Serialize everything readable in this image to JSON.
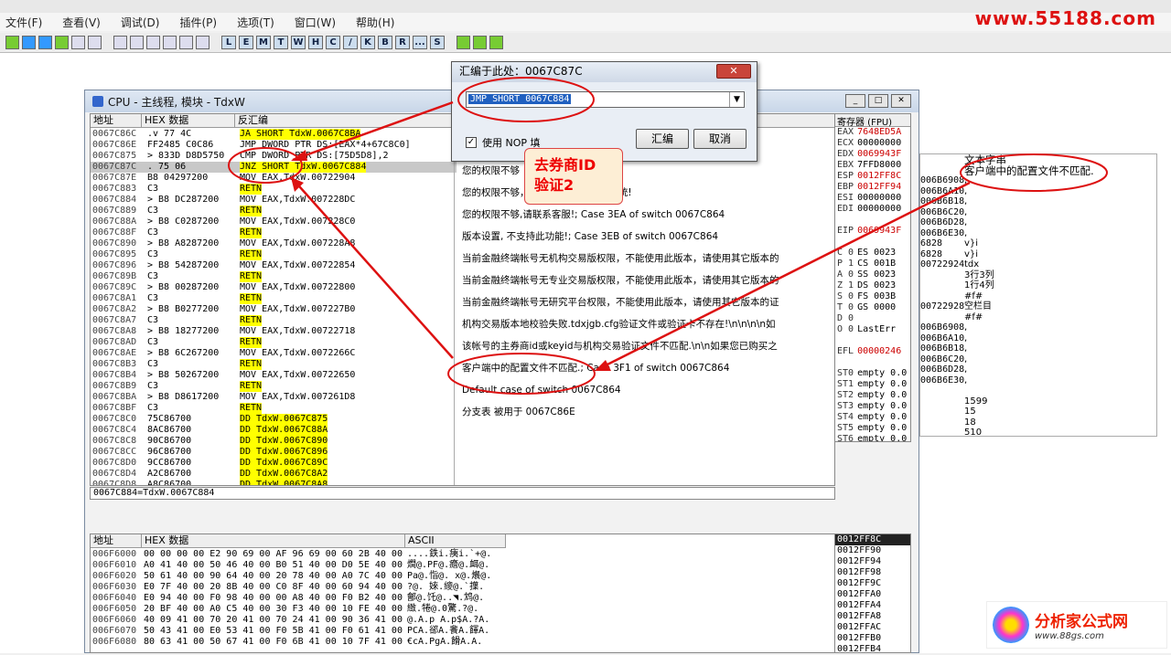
{
  "menu": [
    "文件(F)",
    "查看(V)",
    "调试(D)",
    "插件(P)",
    "选项(T)",
    "窗口(W)",
    "帮助(H)"
  ],
  "toolbar_letters": [
    "L",
    "E",
    "M",
    "T",
    "W",
    "H",
    "C",
    "/",
    "K",
    "B",
    "R",
    "...",
    "S"
  ],
  "brand_top": "www.55188.com",
  "cpu_title": "CPU - 主线程, 模块 - TdxW",
  "headers": {
    "addr": "地址",
    "hex": "HEX 数据",
    "dis": "反汇编",
    "regs": "寄存器 (FPU)",
    "dump_addr": "地址",
    "dump_hex": "HEX 数据",
    "dump_ascii": "ASCII",
    "text_str": "文本字串"
  },
  "disasm": [
    {
      "a": "0067C86C",
      "h": ".v 77 4C",
      "d": "JA SHORT TdxW.0067C8BA",
      "hl": true
    },
    {
      "a": "0067C86E",
      "h": "  FF2485 C0C86",
      "d": "JMP DWORD PTR DS:[EAX*4+67C8C0]",
      "hl": false
    },
    {
      "a": "0067C875",
      "h": ">  833D D8D5750",
      "d": "CMP DWORD PTR DS:[75D5D8],2",
      "hl": false
    },
    {
      "a": "0067C87C",
      "h": ". 75 06",
      "d": "JNZ SHORT TdxW.0067C884",
      "hl": true
    },
    {
      "a": "0067C87E",
      "h": "  B8 04297200",
      "d": "MOV EAX,TdxW.00722904",
      "hl": false
    },
    {
      "a": "0067C883",
      "h": "  C3",
      "d": "RETN",
      "hl": false
    },
    {
      "a": "0067C884",
      "h": ">  B8 DC287200",
      "d": "MOV EAX,TdxW.007228DC",
      "hl": false
    },
    {
      "a": "0067C889",
      "h": "  C3",
      "d": "RETN",
      "hl": false
    },
    {
      "a": "0067C88A",
      "h": ">  B8 C0287200",
      "d": "MOV EAX,TdxW.007228C0",
      "hl": false
    },
    {
      "a": "0067C88F",
      "h": "  C3",
      "d": "RETN",
      "hl": false
    },
    {
      "a": "0067C890",
      "h": ">  B8 A8287200",
      "d": "MOV EAX,TdxW.007228A8",
      "hl": false
    },
    {
      "a": "0067C895",
      "h": "  C3",
      "d": "RETN",
      "hl": false
    },
    {
      "a": "0067C896",
      "h": ">  B8 54287200",
      "d": "MOV EAX,TdxW.00722854",
      "hl": false
    },
    {
      "a": "0067C89B",
      "h": "  C3",
      "d": "RETN",
      "hl": false
    },
    {
      "a": "0067C89C",
      "h": ">  B8 00287200",
      "d": "MOV EAX,TdxW.00722800",
      "hl": false
    },
    {
      "a": "0067C8A1",
      "h": "  C3",
      "d": "RETN",
      "hl": false
    },
    {
      "a": "0067C8A2",
      "h": ">  B8 B0277200",
      "d": "MOV EAX,TdxW.007227B0",
      "hl": false
    },
    {
      "a": "0067C8A7",
      "h": "  C3",
      "d": "RETN",
      "hl": false
    },
    {
      "a": "0067C8A8",
      "h": ">  B8 18277200",
      "d": "MOV EAX,TdxW.00722718",
      "hl": false
    },
    {
      "a": "0067C8AD",
      "h": "  C3",
      "d": "RETN",
      "hl": false
    },
    {
      "a": "0067C8AE",
      "h": ">  B8 6C267200",
      "d": "MOV EAX,TdxW.0072266C",
      "hl": false
    },
    {
      "a": "0067C8B3",
      "h": "  C3",
      "d": "RETN",
      "hl": false
    },
    {
      "a": "0067C8B4",
      "h": ">  B8 50267200",
      "d": "MOV EAX,TdxW.00722650",
      "hl": false
    },
    {
      "a": "0067C8B9",
      "h": "  C3",
      "d": "RETN",
      "hl": false
    },
    {
      "a": "0067C8BA",
      "h": ">  B8 D8617200",
      "d": "MOV EAX,TdxW.007261D8",
      "hl": false
    },
    {
      "a": "0067C8BF",
      "h": "  C3",
      "d": "RETN",
      "hl": false
    },
    {
      "a": "0067C8C0",
      "h": "  75C86700",
      "d": "DD TdxW.0067C875",
      "hl": false
    },
    {
      "a": "0067C8C4",
      "h": "  8AC86700",
      "d": "DD TdxW.0067C88A",
      "hl": false
    },
    {
      "a": "0067C8C8",
      "h": "  90C86700",
      "d": "DD TdxW.0067C890",
      "hl": false
    },
    {
      "a": "0067C8CC",
      "h": "  96C86700",
      "d": "DD TdxW.0067C896",
      "hl": false
    },
    {
      "a": "0067C8D0",
      "h": "  9CC86700",
      "d": "DD TdxW.0067C89C",
      "hl": false
    },
    {
      "a": "0067C8D4",
      "h": "  A2C86700",
      "d": "DD TdxW.0067C8A2",
      "hl": false
    },
    {
      "a": "0067C8D8",
      "h": "  A8C86700",
      "d": "DD TdxW.0067C8A8",
      "hl": false
    }
  ],
  "comments": [
    "您的权限不够",
    "您的权限不够，请联系客服... 交易系统!",
    "您的权限不够,请联系客服!; Case 3EA of switch 0067C864",
    "版本设置, 不支持此功能!; Case 3EB of switch 0067C864",
    "当前金融终端帐号无机构交易版权限，不能使用此版本，请使用其它版本的",
    "当前金融终端帐号无专业交易版权限，不能使用此版本，请使用其它版本的",
    "当前金融终端帐号无研究平台权限，不能使用此版本，请使用其它版本的证",
    "机构交易版本地校验失败.tdxjgb.cfg验证文件或验证卡不存在!\\n\\n\\n\\n如",
    "该帐号的主券商id或keyid与机构交易验证文件不匹配.\\n\\n如果您已购买之",
    "客户端中的配置文件不匹配.; Case 3F1 of switch 0067C864",
    "Default case of switch 0067C864",
    "分支表 被用于 0067C86E"
  ],
  "regs": [
    {
      "n": "EAX",
      "v": "7648ED5A",
      "red": true
    },
    {
      "n": "ECX",
      "v": "00000000",
      "red": false
    },
    {
      "n": "EDX",
      "v": "0069943F",
      "red": true
    },
    {
      "n": "EBX",
      "v": "7FFD8000",
      "red": false
    },
    {
      "n": "ESP",
      "v": "0012FF8C",
      "red": true
    },
    {
      "n": "EBP",
      "v": "0012FF94",
      "red": true
    },
    {
      "n": "ESI",
      "v": "00000000",
      "red": false
    },
    {
      "n": "EDI",
      "v": "00000000",
      "red": false
    },
    {
      "n": "",
      "v": "",
      "red": false
    },
    {
      "n": "EIP",
      "v": "0069943F",
      "red": true
    },
    {
      "n": "",
      "v": "",
      "red": false
    },
    {
      "n": "C 0",
      "v": "ES 0023",
      "red": false
    },
    {
      "n": "P 1",
      "v": "CS 001B",
      "red": false
    },
    {
      "n": "A 0",
      "v": "SS 0023",
      "red": false
    },
    {
      "n": "Z 1",
      "v": "DS 0023",
      "red": false
    },
    {
      "n": "S 0",
      "v": "FS 003B",
      "red": false
    },
    {
      "n": "T 0",
      "v": "GS 0000",
      "red": false
    },
    {
      "n": "D 0",
      "v": "",
      "red": false
    },
    {
      "n": "O 0",
      "v": "LastErr",
      "red": false
    },
    {
      "n": "",
      "v": "",
      "red": false
    },
    {
      "n": "EFL",
      "v": "00000246",
      "red": true
    },
    {
      "n": "",
      "v": "",
      "red": false
    },
    {
      "n": "ST0",
      "v": "empty 0.0",
      "red": false
    },
    {
      "n": "ST1",
      "v": "empty 0.0",
      "red": false
    },
    {
      "n": "ST2",
      "v": "empty 0.0",
      "red": false
    },
    {
      "n": "ST3",
      "v": "empty 0.0",
      "red": false
    },
    {
      "n": "ST4",
      "v": "empty 0.0",
      "red": false
    },
    {
      "n": "ST5",
      "v": "empty 0.0",
      "red": false
    },
    {
      "n": "ST6",
      "v": "empty 0.0",
      "red": false
    },
    {
      "n": "ST7",
      "v": "empty 0.0",
      "red": false
    },
    {
      "n": "",
      "v": "",
      "red": false
    },
    {
      "n": "FST",
      "v": "4000 Cond",
      "red": true
    },
    {
      "n": "FCW",
      "v": "027F Prec",
      "red": false
    }
  ],
  "info_line": "0067C884=TdxW.0067C884",
  "dump": [
    {
      "a": "006F6000",
      "h": "00 00 00 00 E2 90 69 00 AF 96 69 00 60 2B 40 00",
      "s": "....鉄i.痍i.`+@."
    },
    {
      "a": "006F6010",
      "h": "A0 41 40 00 50 46 40 00 B0 51 40 00 D0 5E 40 00",
      "s": "燗@.PF@.癚@.衈@."
    },
    {
      "a": "006F6020",
      "h": "50 61 40 00 90 64 40 00 20 78 40 00 A0 7C 40 00",
      "s": "Pa@.恉@. x@.爘@."
    },
    {
      "a": "006F6030",
      "h": "E0 7F 40 00 20 8B 40 00 C0 8F 40 00 60 94 40 00",
      "s": "?@. 婡.繌@.`擛."
    },
    {
      "a": "006F6040",
      "h": "E0 94 40 00 F0 98 40 00 00 A8 40 00 F0 B2 40 00",
      "s": "鄶@.饦@..◥.鸩@."
    },
    {
      "a": "006F6050",
      "h": "20 BF 40 00 A0 C5 40 00 30 F3 40 00 10 FE 40 00",
      "s": " 緻.犈@.0驚.?@."
    },
    {
      "a": "006F6060",
      "h": "40 09 41 00 70 20 41 00 70 24 41 00 90 36 41 00",
      "s": "@.A.p A.p$A.?A."
    },
    {
      "a": "006F6070",
      "h": "50 43 41 00 E0 53 41 00 F0 5B 41 00 F0 61 41 00",
      "s": "PCA.郤A.餥A.餫A."
    },
    {
      "a": "006F6080",
      "h": "80 63 41 00 50 67 41 00 F0 6B 41 00 10 7F 41 00",
      "s": "€cA.PgA.餶A.A."
    }
  ],
  "strings_panel": [
    {
      "l": "",
      "r": "文本字串"
    },
    {
      "l": "",
      "r": "客户端中的配置文件不匹配."
    },
    {
      "l": "006B6908",
      "r": ","
    },
    {
      "l": "006B6A10",
      "r": ","
    },
    {
      "l": "006B6B18",
      "r": ","
    },
    {
      "l": "006B6C20",
      "r": ","
    },
    {
      "l": "006B6D28",
      "r": ","
    },
    {
      "l": "006B6E30",
      "r": ","
    },
    {
      "l": "6828",
      "r": "v}i"
    },
    {
      "l": "6828",
      "r": "v}i"
    },
    {
      "l": "00722924",
      "r": "tdx"
    },
    {
      "l": "",
      "r": "3行3列"
    },
    {
      "l": "",
      "r": "1行4列"
    },
    {
      "l": "",
      "r": "#f#"
    },
    {
      "l": "00722928",
      "r": "空栏目"
    },
    {
      "l": "",
      "r": "#f#"
    },
    {
      "l": "006B6908",
      "r": ","
    },
    {
      "l": "006B6A10",
      "r": ","
    },
    {
      "l": "006B6B18",
      "r": ","
    },
    {
      "l": "006B6C20",
      "r": ","
    },
    {
      "l": "006B6D28",
      "r": ","
    },
    {
      "l": "006B6E30",
      "r": ","
    },
    {
      "l": "",
      "r": ""
    },
    {
      "l": "",
      "r": "1599"
    },
    {
      "l": "",
      "r": "15"
    },
    {
      "l": "",
      "r": "18"
    },
    {
      "l": "",
      "r": "510"
    }
  ],
  "stack": [
    "0012FF8C",
    "0012FF90",
    "0012FF94",
    "0012FF98",
    "0012FF9C",
    "0012FFA0",
    "0012FFA4",
    "0012FFA8",
    "0012FFAC",
    "0012FFB0",
    "0012FFB4"
  ],
  "dialog": {
    "title": "汇编于此处：0067C87C",
    "close": "✕",
    "input": "JMP SHORT 0067C884",
    "check_label": "使用 NOP 填",
    "assemble": "汇编",
    "cancel": "取消"
  },
  "callout": {
    "line1": "去券商ID",
    "line2": "验证2"
  },
  "logo2": {
    "t1": "分析家公式网",
    "t2": "www.88gs.com"
  }
}
